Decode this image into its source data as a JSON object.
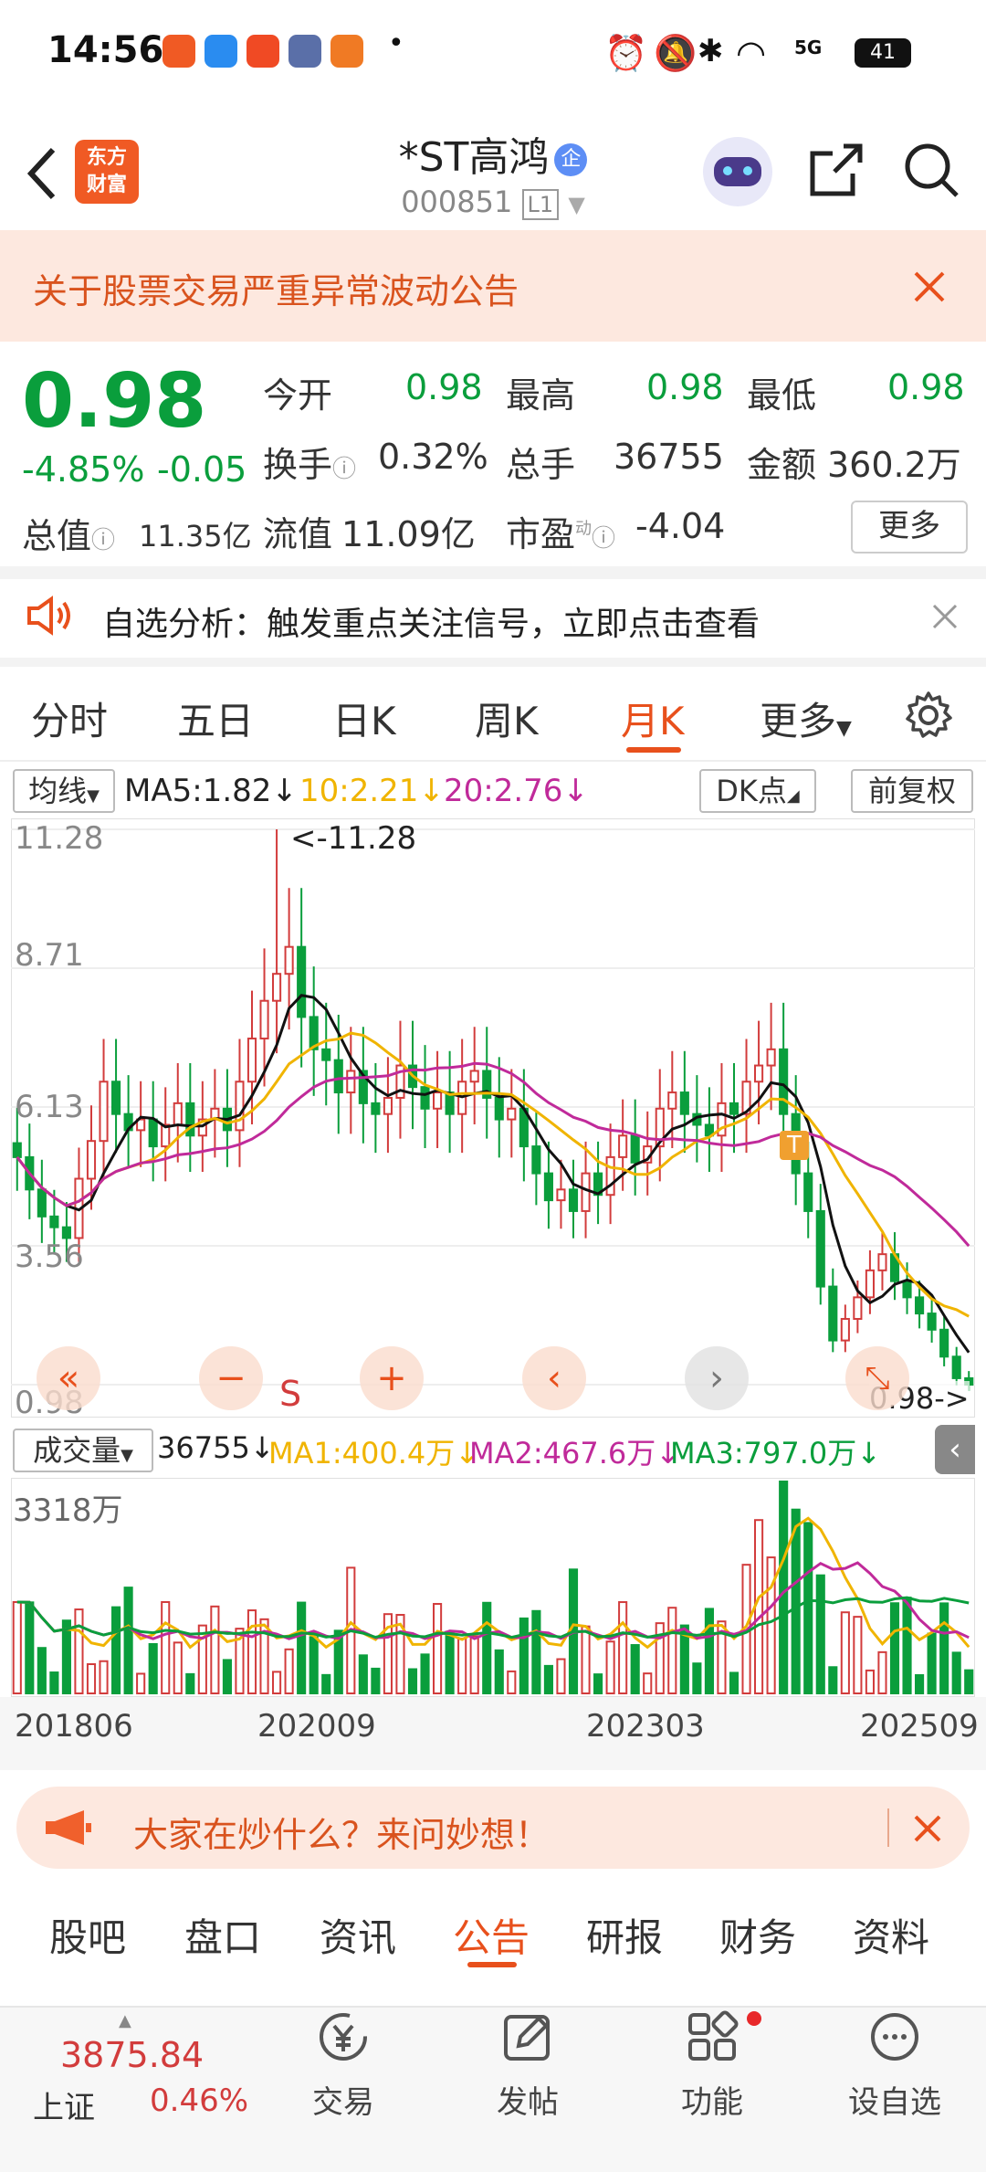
{
  "status": {
    "time": "14:56",
    "battery": "41",
    "network": "5G"
  },
  "header": {
    "logo": [
      "东方",
      "财富"
    ],
    "name": "*ST高鸿",
    "badge": "企",
    "code": "000851",
    "level": "L1"
  },
  "announce": {
    "text": "关于股票交易严重异常波动公告"
  },
  "quote": {
    "price": "0.98",
    "pct": "-4.85%",
    "chg": "-0.05",
    "open_l": "今开",
    "open_v": "0.98",
    "high_l": "最高",
    "high_v": "0.98",
    "low_l": "最低",
    "low_v": "0.98",
    "turn_l": "换手",
    "turn_v": "0.32%",
    "vol_l": "总手",
    "vol_v": "36755",
    "amt_l": "金额",
    "amt_v": "360.2万",
    "mcap_l": "总值",
    "mcap_v": "11.35亿",
    "float_l": "流值",
    "float_v": "11.09亿",
    "pe_l": "市盈",
    "pe_sup": "动",
    "pe_v": "-4.04",
    "more": "更多"
  },
  "analysis": {
    "text": "自选分析：触发重点关注信号，立即点击查看"
  },
  "ktabs": {
    "t1": "分时",
    "t2": "五日",
    "t3": "日K",
    "t4": "周K",
    "t5": "月K",
    "t6": "更多"
  },
  "kchart": {
    "ma_select": "均线",
    "ma5": "MA5:1.82↓",
    "ma10": "10:2.21↓",
    "ma20": "20:2.76↓",
    "dk": "DK点",
    "fuquan": "前复权",
    "y_labels": [
      "11.28",
      "8.71",
      "6.13",
      "3.56",
      "0.98"
    ],
    "max_marker": "<-11.28",
    "last_marker": "0.98->",
    "t_marker": "T",
    "s_marker": "S"
  },
  "volume": {
    "select": "成交量",
    "vol": "36755↓",
    "ma1": "MA1:400.4万↓",
    "ma2": "MA2:467.6万↓",
    "ma3": "MA3:797.0万↓",
    "max_label": "3318万",
    "x_labels": [
      "201806",
      "202009",
      "202303",
      "202509"
    ]
  },
  "promo": {
    "text": "大家在炒什么？来问妙想！"
  },
  "btabs": {
    "b1": "股吧",
    "b2": "盘口",
    "b3": "资讯",
    "b4": "公告",
    "b5": "研报",
    "b6": "财务",
    "b7": "资料"
  },
  "bottom": {
    "index_val": "3875.84",
    "index_name": "上证",
    "index_pct": "0.46%",
    "trade": "交易",
    "post": "发帖",
    "func": "功能",
    "watch": "设自选"
  },
  "colors": {
    "up": "#d23c3c",
    "down": "#0a9e3c",
    "accent": "#e8501c",
    "ma5": "#111111",
    "ma10": "#f0b400",
    "ma20": "#c02a9a"
  }
}
